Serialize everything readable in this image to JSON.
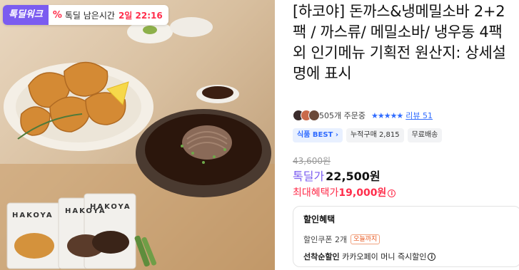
{
  "deal": {
    "badge": "톡딜워크",
    "pct_icon": "%",
    "timer_label": "톡딜 남은시간",
    "timer_value": "2일 22:16"
  },
  "product": {
    "title": "[하코야] 돈까스&냉메밀소바 2+2팩 / 까스류/ 메밀소바/ 냉우동 4팩 외 인기메뉴 기획전 원산지: 상세설명에 표시",
    "order_count": "505개 주문중",
    "stars": "★★★★★",
    "review_link": "리뷰 51",
    "rating": 5
  },
  "tags": {
    "best": "식품 BEST",
    "cumulative": "누적구매 2,815",
    "shipping": "무료배송"
  },
  "price": {
    "original": "43,600원",
    "deal_label": "톡딜가",
    "deal_value": "22,500원",
    "max_benefit_label": "최대혜택가",
    "max_benefit_value": "19,000원",
    "info_icon": "i"
  },
  "discount": {
    "title": "할인혜택",
    "coupon_text": "할인쿠폰 2개",
    "today_badge": "오늘까지",
    "first_come_label": "선착순할인",
    "first_come_text": "카카오페이 머니 즉시할인"
  },
  "image": {
    "brand_text": "HAKOYA"
  },
  "colors": {
    "accent_purple": "#7b5cf0",
    "accent_red": "#ff2d4b",
    "link_blue": "#2f6bff"
  }
}
